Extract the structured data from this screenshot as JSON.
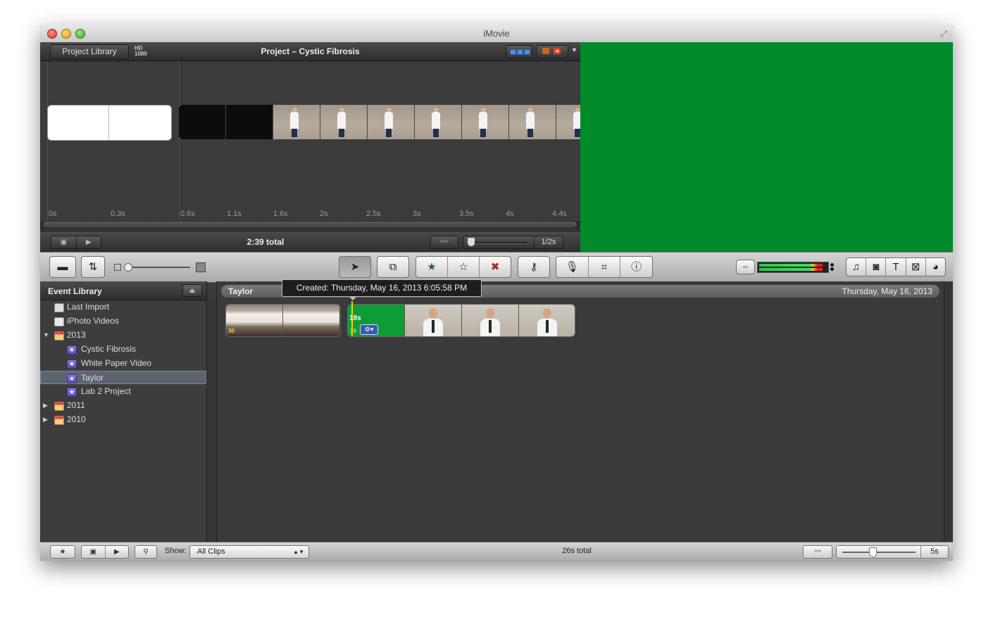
{
  "window": {
    "title": "iMovie"
  },
  "project": {
    "back_label": "Project Library",
    "hd_badge": [
      "HD",
      "1080"
    ],
    "title": "Project – Cystic Fibrosis",
    "time_ticks": [
      "0s",
      "0.3s",
      "0.6s",
      "1.1s",
      "1.6s",
      "2s",
      "2.5s",
      "3s",
      "3.5s",
      "4s",
      "4.4s"
    ],
    "total": "2:39 total",
    "zoom_value": "1/2s"
  },
  "event_library": {
    "title": "Event Library",
    "items": [
      {
        "label": "Last Import",
        "icon": "film-icon",
        "level": 0
      },
      {
        "label": "iPhoto Videos",
        "icon": "iphoto-icon",
        "level": 0
      },
      {
        "label": "2013",
        "icon": "calendar-icon",
        "level": 0,
        "expanded": true
      },
      {
        "label": "Cystic Fibrosis",
        "icon": "event-star-icon",
        "level": 1
      },
      {
        "label": "White Paper Video",
        "icon": "event-star-icon",
        "level": 1
      },
      {
        "label": "Taylor",
        "icon": "event-star-icon",
        "level": 1,
        "selected": true
      },
      {
        "label": "Lab 2 Project",
        "icon": "event-star-icon",
        "level": 1
      },
      {
        "label": "2011",
        "icon": "calendar-icon",
        "level": 0,
        "expanded": false
      },
      {
        "label": "2010",
        "icon": "calendar-icon",
        "level": 0,
        "expanded": false
      }
    ]
  },
  "event_browser": {
    "event_name": "Taylor",
    "event_date": "Thursday, May 16, 2013",
    "tooltip": "Created: Thursday, May 16, 2013 6:05:58 PM",
    "clip_duration_label": "18s",
    "fps_badge": "30"
  },
  "bottom": {
    "show_label": "Show:",
    "show_value": "All Clips",
    "total": "26s total",
    "zoom_value": "5s"
  },
  "colors": {
    "viewer": "#008a2a",
    "selection": "#5c6470"
  }
}
